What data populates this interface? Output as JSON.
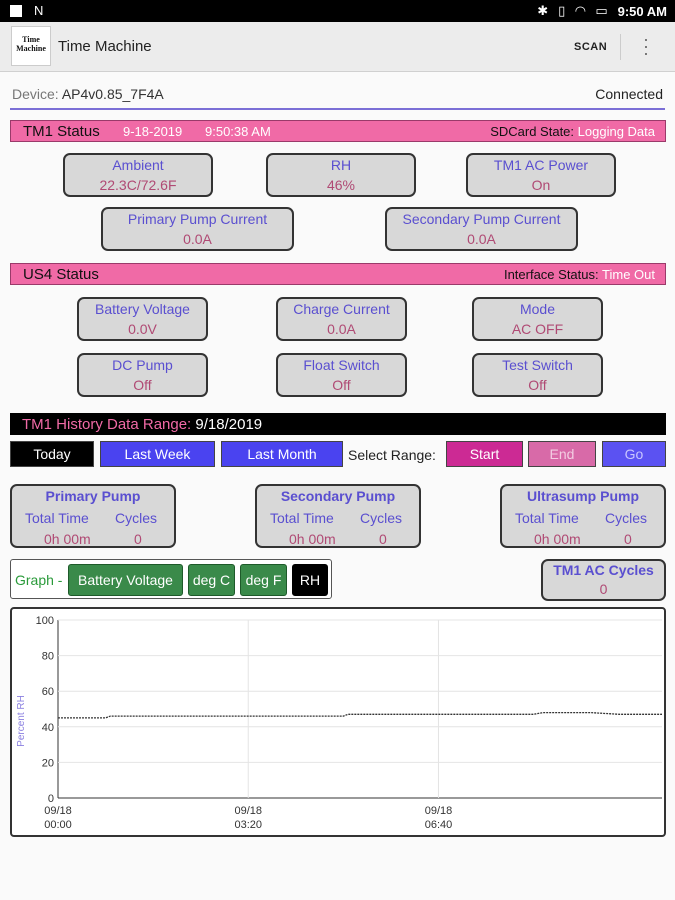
{
  "statusbar": {
    "left_icon": "N",
    "time": "9:50 AM"
  },
  "appbar": {
    "logo_line1": "Time",
    "logo_line2": "Machine",
    "title": "Time Machine",
    "scan_label": "SCAN"
  },
  "device": {
    "label": "Device:",
    "name": "AP4v0.85_7F4A",
    "state": "Connected"
  },
  "tm1_status": {
    "title": "TM1 Status",
    "date": "9-18-2019",
    "time": "9:50:38 AM",
    "sdcard_label": "SDCard State:",
    "sdcard_value": "Logging Data",
    "tiles": [
      {
        "label": "Ambient",
        "value": "22.3C/72.6F"
      },
      {
        "label": "RH",
        "value": "46%"
      },
      {
        "label": "TM1 AC Power",
        "value": "On"
      },
      {
        "label": "Primary Pump Current",
        "value": "0.0A"
      },
      {
        "label": "Secondary Pump Current",
        "value": "0.0A"
      }
    ]
  },
  "us4_status": {
    "title": "US4 Status",
    "iface_label": "Interface Status:",
    "iface_value": "Time Out",
    "tiles": [
      {
        "label": "Battery Voltage",
        "value": "0.0V"
      },
      {
        "label": "Charge Current",
        "value": "0.0A"
      },
      {
        "label": "Mode",
        "value": "AC OFF"
      },
      {
        "label": "DC Pump",
        "value": "Off"
      },
      {
        "label": "Float Switch",
        "value": "Off"
      },
      {
        "label": "Test Switch",
        "value": "Off"
      }
    ]
  },
  "history": {
    "label": "TM1 History Data Range:",
    "range": "9/18/2019",
    "buttons": {
      "today": "Today",
      "last_week": "Last Week",
      "last_month": "Last Month"
    },
    "select_range": "Select Range:",
    "start": "Start",
    "end": "End",
    "go": "Go"
  },
  "pumps": [
    {
      "title": "Primary Pump",
      "total_time_label": "Total Time",
      "cycles_label": "Cycles",
      "total_time": "0h 00m",
      "cycles": "0"
    },
    {
      "title": "Secondary Pump",
      "total_time_label": "Total Time",
      "cycles_label": "Cycles",
      "total_time": "0h 00m",
      "cycles": "0"
    },
    {
      "title": "Ultrasump Pump",
      "total_time_label": "Total Time",
      "cycles_label": "Cycles",
      "total_time": "0h 00m",
      "cycles": "0"
    }
  ],
  "graph": {
    "label": "Graph -",
    "buttons": [
      "Battery Voltage",
      "deg C",
      "deg F",
      "RH"
    ],
    "selected": "RH"
  },
  "ac_cycles": {
    "title": "TM1 AC Cycles",
    "value": "0"
  },
  "colors": {
    "pink": "#f06aa6",
    "blue": "#4a43f0",
    "magenta": "#cc2a94",
    "green": "#3a8a4a",
    "label_purple": "#5a4fd0",
    "value_rose": "#b04a74"
  },
  "chart_data": {
    "type": "line",
    "ylabel": "Percent RH",
    "ylim": [
      0,
      100
    ],
    "yticks": [
      "0",
      "20",
      "40",
      "60",
      "80",
      "100"
    ],
    "xticks": [
      {
        "at": 0,
        "line1": "09/18",
        "line2": "00:00"
      },
      {
        "at": 200,
        "line1": "09/18",
        "line2": "03:20"
      },
      {
        "at": 400,
        "line1": "09/18",
        "line2": "06:40"
      }
    ],
    "xlim": [
      0,
      635
    ],
    "series": [
      {
        "x": [
          0,
          50,
          55,
          90,
          150,
          200,
          250,
          300,
          305,
          360,
          400,
          450,
          500,
          510,
          530,
          560,
          590,
          635
        ],
        "y": [
          45,
          45,
          46,
          46,
          46,
          46,
          46,
          46,
          47,
          47,
          47,
          47,
          47,
          48,
          48,
          48,
          47,
          47
        ]
      }
    ]
  }
}
